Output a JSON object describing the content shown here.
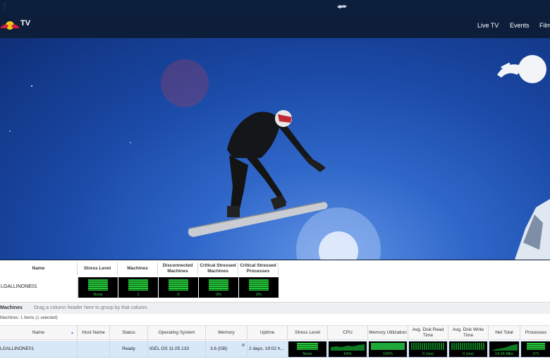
{
  "browser": {
    "menu_icon": "menu-dots-icon",
    "tab_icon": "redbull-bull-icon"
  },
  "nav": {
    "logo_text": "TV",
    "links": [
      "Live TV",
      "Events",
      "Film"
    ]
  },
  "colors": {
    "accent_green": "#34d04a",
    "selection": "#d8e8f8",
    "nav_bg": "#0d1e3a"
  },
  "summary": {
    "headers": [
      "Name",
      "Stress Level",
      "Machines",
      "Disconnected Machines",
      "Critical Stressed Machines",
      "Critical Stressed Processes"
    ],
    "row": {
      "name": "LGALLINONE01",
      "stress": "None",
      "machines": "1",
      "disconnected": "0",
      "crit_machines": "0%",
      "crit_processes": "0%"
    }
  },
  "machines": {
    "group_title": "Machines",
    "group_hint": "Drag a column header here to group by that column.",
    "count_text": "Machines: 1 Items (1 selected)",
    "headers": [
      "Name",
      "Host Name",
      "Status",
      "Operating System",
      "Memory",
      "Uptime",
      "Stress Level",
      "CPU",
      "Memory Utilization",
      "Avg. Disk Read Time",
      "Avg. Disk Write Time",
      "Net Total",
      "Processes"
    ],
    "row": {
      "name": "LGALLINONE01",
      "host": "",
      "status": "Ready",
      "os": "IGEL OS 11.05.133",
      "memory": "3.6 (GB)",
      "uptime": "2 days, 19:02 h...",
      "stress": "None",
      "cpu": "54%",
      "mem_util": "100%",
      "disk_read": "0 (ms)",
      "disk_write": "0 (ms)",
      "net_total": "14.26 Mbs",
      "processes": "271"
    }
  }
}
